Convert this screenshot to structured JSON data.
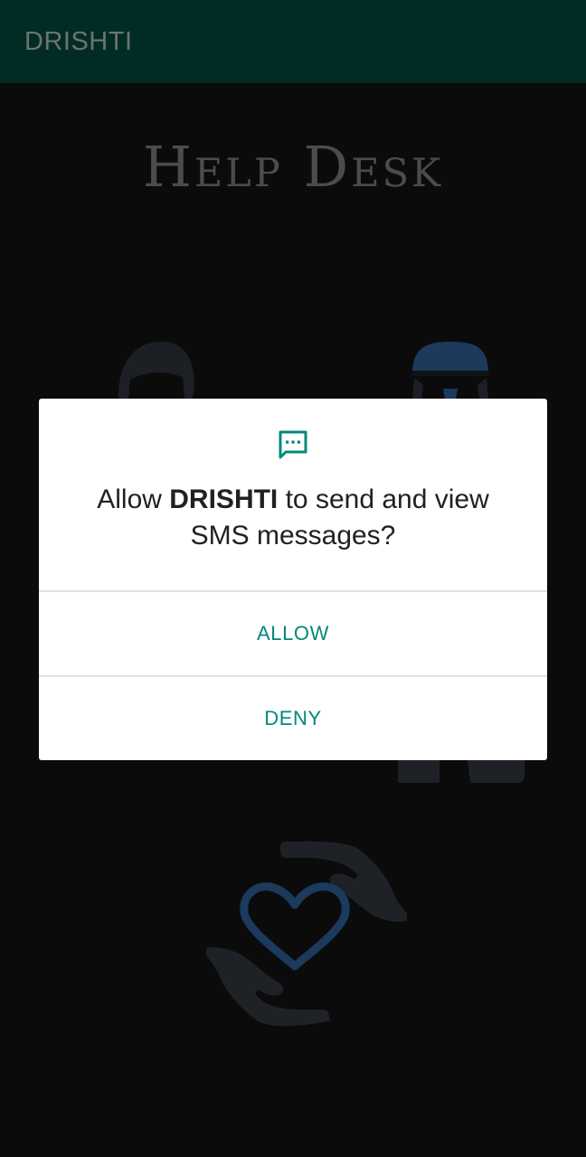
{
  "app_bar": {
    "title": "DRISHTI"
  },
  "page": {
    "title": "Help Desk"
  },
  "dialog": {
    "icon": "sms-message-icon",
    "message_prefix": "Allow ",
    "app_name": "DRISHTI",
    "message_suffix": " to send and view SMS messages?",
    "allow_label": "ALLOW",
    "deny_label": "DENY"
  },
  "colors": {
    "app_bar": "#012b25",
    "accent": "#00897b",
    "background": "#0b0b0b"
  }
}
